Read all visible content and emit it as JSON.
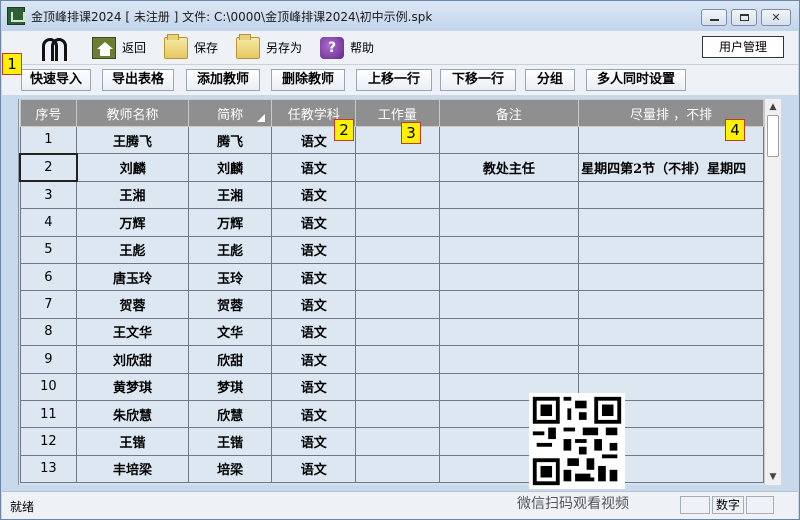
{
  "window": {
    "title": "金顶峰排课2024 [ 未注册 ] 文件: C:\\0000\\金顶峰排课2024\\初中示例.spk"
  },
  "menu": {
    "items": [
      {
        "label": "返回",
        "icon": "home-icon"
      },
      {
        "label": "保存",
        "icon": "folder-icon"
      },
      {
        "label": "另存为",
        "icon": "folder-icon"
      },
      {
        "label": "帮助",
        "icon": "help-book-icon"
      }
    ],
    "user_button": "用户管理"
  },
  "toolbar": {
    "buttons": [
      "快速导入",
      "导出表格",
      "添加教师",
      "删除教师",
      "上移一行",
      "下移一行",
      "分组",
      "多人同时设置"
    ]
  },
  "badges": [
    "1",
    "2",
    "3",
    "4"
  ],
  "table": {
    "headers": [
      "序号",
      "教师名称",
      "简称",
      "任教学科",
      "工作量",
      "备注",
      "尽量排 ，不排"
    ],
    "rows": [
      [
        "1",
        "王腾飞",
        "腾飞",
        "语文",
        "",
        "",
        ""
      ],
      [
        "2",
        "刘麟",
        "刘麟",
        "语文",
        "",
        "教处主任",
        "星期四第2节（不排）星期四"
      ],
      [
        "3",
        "王湘",
        "王湘",
        "语文",
        "",
        "",
        ""
      ],
      [
        "4",
        "万辉",
        "万辉",
        "语文",
        "",
        "",
        ""
      ],
      [
        "5",
        "王彪",
        "王彪",
        "语文",
        "",
        "",
        ""
      ],
      [
        "6",
        "唐玉玲",
        "玉玲",
        "语文",
        "",
        "",
        ""
      ],
      [
        "7",
        "贺蓉",
        "贺蓉",
        "语文",
        "",
        "",
        ""
      ],
      [
        "8",
        "王文华",
        "文华",
        "语文",
        "",
        "",
        ""
      ],
      [
        "9",
        "刘欣甜",
        "欣甜",
        "语文",
        "",
        "",
        ""
      ],
      [
        "10",
        "黄梦琪",
        "梦琪",
        "语文",
        "",
        "",
        ""
      ],
      [
        "11",
        "朱欣慧",
        "欣慧",
        "语文",
        "",
        "",
        ""
      ],
      [
        "12",
        "王锴",
        "王锴",
        "语文",
        "",
        "",
        ""
      ],
      [
        "13",
        "丰培梁",
        "培梁",
        "语文",
        "",
        "",
        ""
      ]
    ]
  },
  "overlay": {
    "caption": "微信扫码观看视频"
  },
  "status": {
    "text": "就绪",
    "num_label": "数字"
  }
}
